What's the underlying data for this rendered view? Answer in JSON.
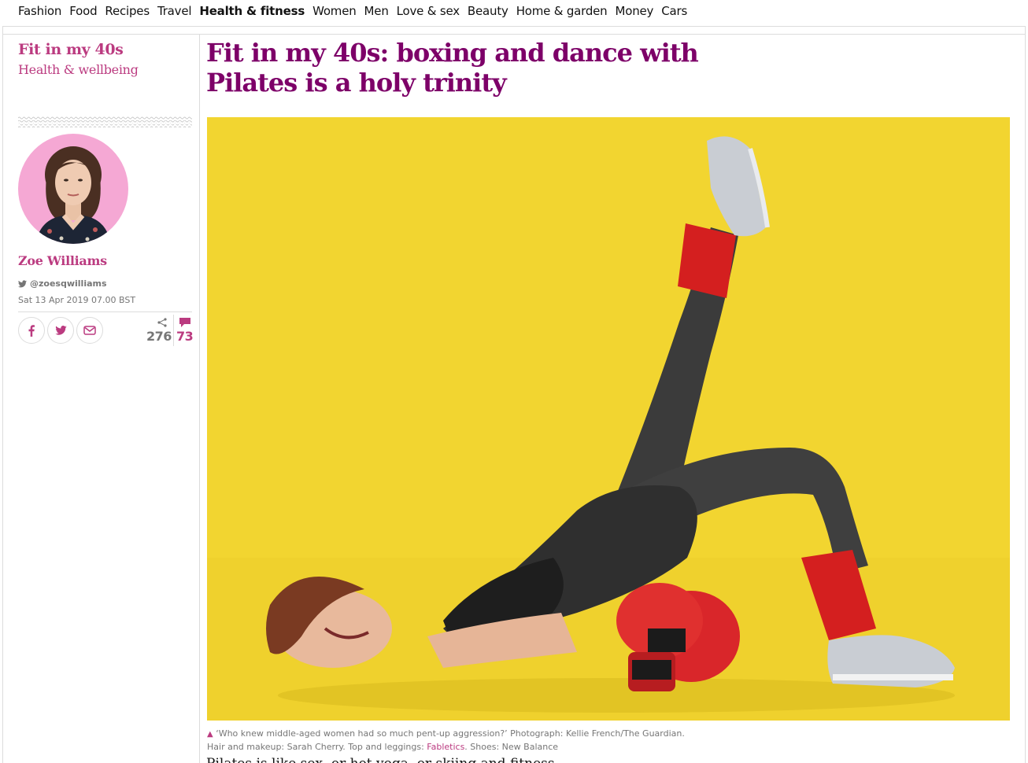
{
  "nav": {
    "items": [
      {
        "label": "Fashion",
        "active": false
      },
      {
        "label": "Food",
        "active": false
      },
      {
        "label": "Recipes",
        "active": false
      },
      {
        "label": "Travel",
        "active": false
      },
      {
        "label": "Health & fitness",
        "active": true
      },
      {
        "label": "Women",
        "active": false
      },
      {
        "label": "Men",
        "active": false
      },
      {
        "label": "Love & sex",
        "active": false
      },
      {
        "label": "Beauty",
        "active": false
      },
      {
        "label": "Home & garden",
        "active": false
      },
      {
        "label": "Money",
        "active": false
      },
      {
        "label": "Cars",
        "active": false
      }
    ]
  },
  "series": {
    "title": "Fit in my 40s",
    "subtitle": "Health & wellbeing"
  },
  "author": {
    "name": "Zoe Williams",
    "twitter": "@zoesqwilliams",
    "date": "Sat 13 Apr 2019 07.00 BST"
  },
  "share": {
    "facebook_icon": "facebook-icon",
    "twitter_icon": "twitter-icon",
    "email_icon": "email-icon",
    "share_count": "276",
    "comment_count": "73"
  },
  "article": {
    "headline": "Fit in my 40s: boxing and dance with Pilates is a holy trinity",
    "image_alt": "Woman in black leggings and red boxing gloves doing a Pilates leg raise on a yellow background",
    "caption": {
      "quote": "‘Who knew middle-aged women had so much pent-up aggression?’ Photograph: Kellie French/The Guardian. Hair and makeup: Sarah Cherry. Top and leggings: ",
      "link": "Fabletics",
      "after": ". Shoes: New Balance"
    },
    "body_start": "Pilates is like sex, or hot yoga, or skiing and fitness…"
  },
  "colors": {
    "accent": "#bb3b80",
    "headline": "#7d0068",
    "image_bg": "#f2d530"
  }
}
